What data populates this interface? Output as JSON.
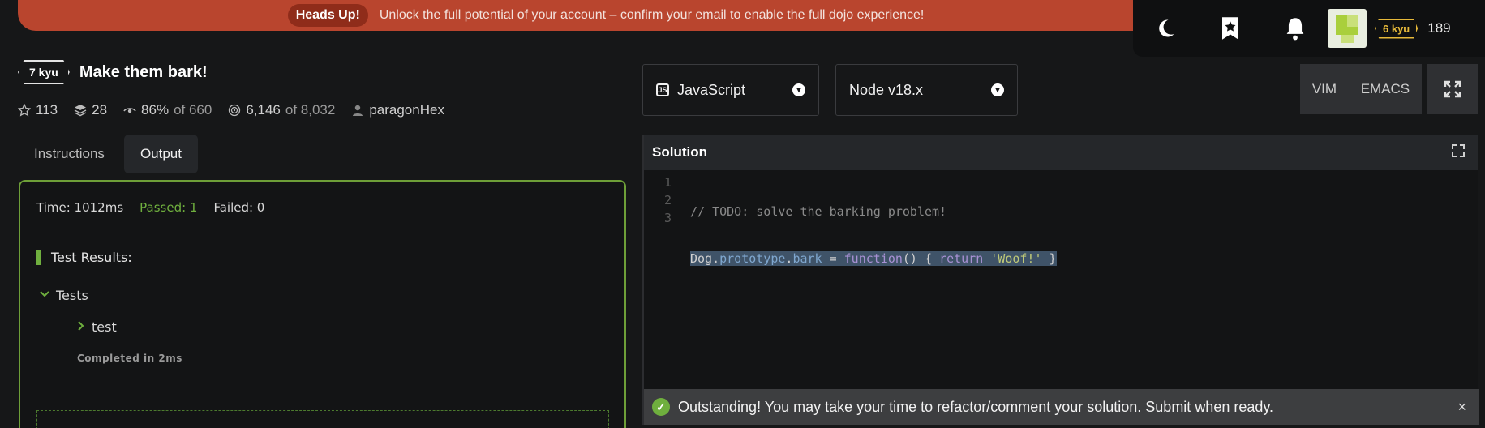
{
  "banner": {
    "pill": "Heads Up!",
    "message": "Unlock the full potential of your account – confirm your email to enable the full dojo experience!"
  },
  "user": {
    "kyu": "6 kyu",
    "honor": "189",
    "icons": [
      "moon-icon",
      "bookmark-icon",
      "bell-icon"
    ]
  },
  "kata": {
    "rank": "7 kyu",
    "title": "Make them bark!",
    "stars": "113",
    "collections": "28",
    "satisfaction": "86%",
    "satisfaction_of": "of 660",
    "completed": "6,146",
    "completed_of": "of 8,032",
    "author": "paragonHex"
  },
  "tabs": [
    {
      "label": "Instructions"
    },
    {
      "label": "Output"
    }
  ],
  "output": {
    "time": "Time: 1012ms",
    "passed": "Passed: 1",
    "failed": "Failed: 0",
    "results_title": "Test Results:",
    "group": "Tests",
    "test": "test",
    "completed": "Completed in 2ms"
  },
  "language": {
    "label": "JavaScript"
  },
  "runtime": {
    "label": "Node v18.x"
  },
  "modes": {
    "vim": "VIM",
    "emacs": "EMACS"
  },
  "solution": {
    "title": "Solution",
    "line_numbers": [
      "1",
      "2",
      "3"
    ],
    "line1": "// TODO: solve the barking problem!",
    "line2": {
      "obj": "Dog",
      "dot1": ".",
      "proto": "prototype",
      "dot2": ".",
      "method": "bark",
      "eq": " = ",
      "fn": "function",
      "paren": "() { ",
      "ret": "return",
      "space": " ",
      "str": "'Woof!'",
      "close": " }"
    }
  },
  "toast": {
    "message": "Outstanding! You may take your time to refactor/comment your solution. Submit when ready.",
    "close": "×"
  },
  "colors": {
    "accent_green": "#6faf3e",
    "banner": "#b9452e",
    "kyu_yellow": "#e6b93a"
  }
}
